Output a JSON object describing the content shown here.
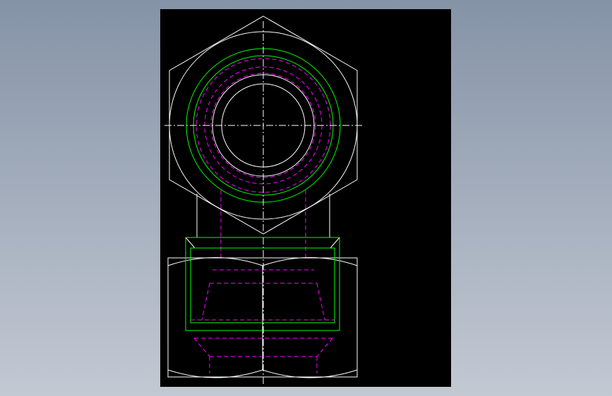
{
  "colors": {
    "canvas": "#000000",
    "outline": "#ffffff",
    "thread": "#00ff00",
    "hidden": "#ff00ff",
    "background_top": "#8593a7",
    "background_bottom": "#c3c9d3"
  },
  "views": [
    "top-view",
    "front-view"
  ],
  "line_types": [
    "continuous",
    "hidden-dashed",
    "center-dash-dot"
  ]
}
